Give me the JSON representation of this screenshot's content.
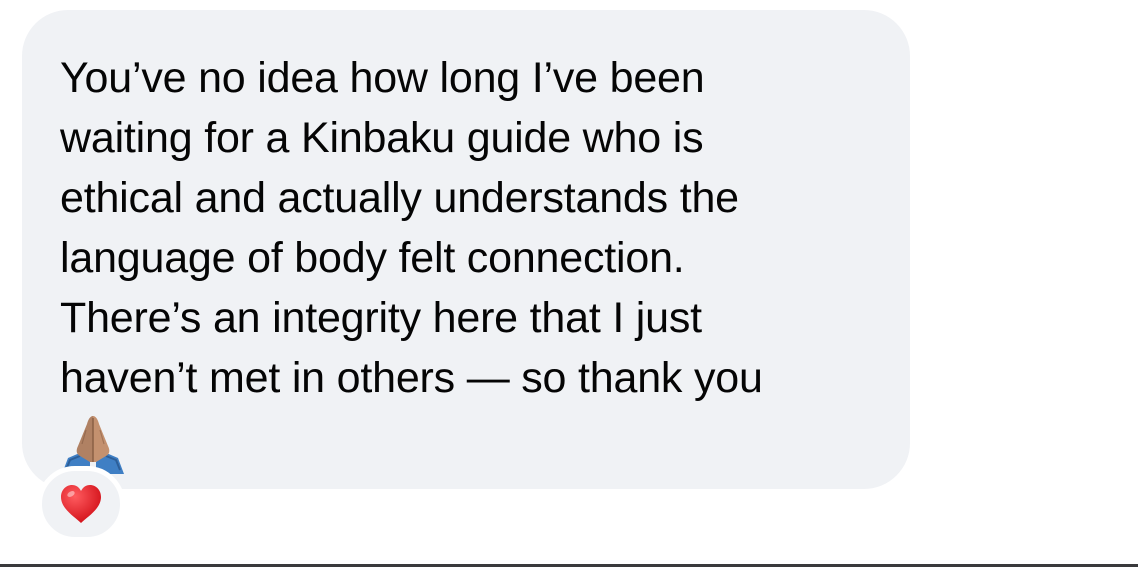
{
  "message": {
    "text": "You’ve no idea how long I’ve been\nwaiting for a Kinbaku guide who is\nethical and actually understands the\nlanguage of body felt connection.\nThere’s an integrity here that I just\nhaven’t met in others — so thank you",
    "trailing_emoji": "folded-hands-emoji"
  },
  "reaction": {
    "icon": "red-heart-icon",
    "color": "#e0202a"
  },
  "colors": {
    "bubble": "#f0f2f5",
    "text": "#050505",
    "background": "#ffffff"
  }
}
